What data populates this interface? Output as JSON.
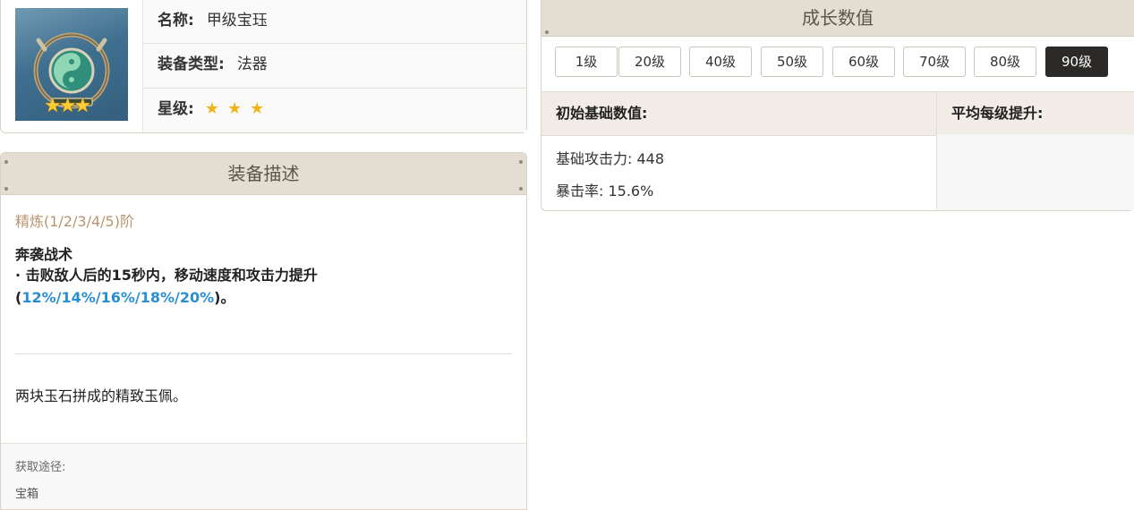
{
  "item": {
    "name_label": "名称:",
    "name": "甲级宝珏",
    "type_label": "装备类型:",
    "type": "法器",
    "rarity_label": "星级:",
    "rarity_stars": "★★★",
    "rarity_count": 3,
    "thumb_stars": "★★★"
  },
  "description": {
    "header": "装备描述",
    "refine": "精炼(1/2/3/4/5)阶",
    "skill_name": "奔袭战术",
    "skill_prefix": "· 击败敌人后的15秒内，移动速度和攻击力提升(",
    "skill_values": "12%/14%/16%/18%/20%",
    "skill_suffix": ")。",
    "flavor": "两块玉石拼成的精致玉佩。",
    "source_label": "获取途径:",
    "source_value": "宝箱"
  },
  "growth": {
    "header": "成长数值",
    "levels": [
      "1级",
      "20级",
      "40级",
      "50级",
      "60级",
      "70级",
      "80级",
      "90级"
    ],
    "active_level": "90级",
    "col_base": "初始基础数值:",
    "col_avg": "平均每级提升:",
    "stats": [
      "基础攻击力: 448",
      "暴击率: 15.6%"
    ]
  },
  "colors": {
    "header_bg": "#e4ddd1",
    "active_tab": "#2c2a28",
    "skill_value_blue": "#2a8fd1",
    "refine_text": "#b8956e",
    "star_gold": "#f0b419"
  }
}
